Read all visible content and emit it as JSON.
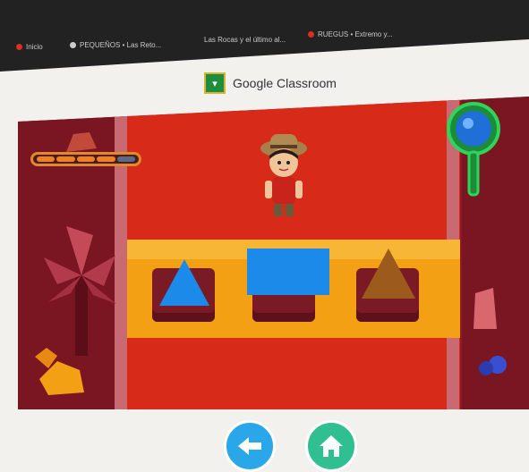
{
  "browser": {
    "tabs": [
      {
        "label": "Inicio",
        "color": "#d93025"
      },
      {
        "label": "PEQUEÑOS • Las Reto...",
        "color": "#cccccc"
      },
      {
        "label": "Las Rocas y el último al...",
        "color": "#888888"
      },
      {
        "label": "RUEGUS • Extremo y...",
        "color": "#d93025"
      }
    ]
  },
  "header": {
    "title": "Google Classroom",
    "logo_icon": "google-classroom-icon"
  },
  "game": {
    "progress": {
      "filled_segments": 4,
      "total_segments": 5
    },
    "shapes": [
      {
        "name": "triangle",
        "color": "#1c8ae8"
      },
      {
        "name": "rectangle",
        "color": "#1c8ae8"
      },
      {
        "name": "triangle",
        "color": "#9c5a1c"
      }
    ],
    "colors": {
      "floor": "#d72a18",
      "shelf": "#f4a015",
      "walls": "#7a1522",
      "shape_blue": "#1c8ae8",
      "shape_brown": "#9c5a1c"
    }
  },
  "nav": {
    "back_icon": "arrow-left-icon",
    "home_icon": "home-icon"
  }
}
